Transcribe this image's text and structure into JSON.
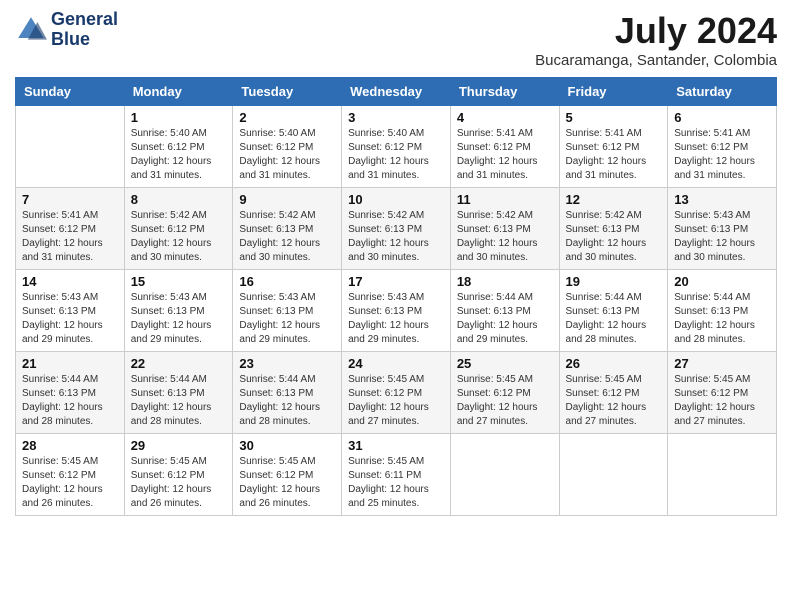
{
  "header": {
    "logo_line1": "General",
    "logo_line2": "Blue",
    "month_year": "July 2024",
    "location": "Bucaramanga, Santander, Colombia"
  },
  "weekdays": [
    "Sunday",
    "Monday",
    "Tuesday",
    "Wednesday",
    "Thursday",
    "Friday",
    "Saturday"
  ],
  "weeks": [
    [
      {
        "day": "",
        "sunrise": "",
        "sunset": "",
        "daylight": ""
      },
      {
        "day": "1",
        "sunrise": "Sunrise: 5:40 AM",
        "sunset": "Sunset: 6:12 PM",
        "daylight": "Daylight: 12 hours and 31 minutes."
      },
      {
        "day": "2",
        "sunrise": "Sunrise: 5:40 AM",
        "sunset": "Sunset: 6:12 PM",
        "daylight": "Daylight: 12 hours and 31 minutes."
      },
      {
        "day": "3",
        "sunrise": "Sunrise: 5:40 AM",
        "sunset": "Sunset: 6:12 PM",
        "daylight": "Daylight: 12 hours and 31 minutes."
      },
      {
        "day": "4",
        "sunrise": "Sunrise: 5:41 AM",
        "sunset": "Sunset: 6:12 PM",
        "daylight": "Daylight: 12 hours and 31 minutes."
      },
      {
        "day": "5",
        "sunrise": "Sunrise: 5:41 AM",
        "sunset": "Sunset: 6:12 PM",
        "daylight": "Daylight: 12 hours and 31 minutes."
      },
      {
        "day": "6",
        "sunrise": "Sunrise: 5:41 AM",
        "sunset": "Sunset: 6:12 PM",
        "daylight": "Daylight: 12 hours and 31 minutes."
      }
    ],
    [
      {
        "day": "7",
        "sunrise": "Sunrise: 5:41 AM",
        "sunset": "Sunset: 6:12 PM",
        "daylight": "Daylight: 12 hours and 31 minutes."
      },
      {
        "day": "8",
        "sunrise": "Sunrise: 5:42 AM",
        "sunset": "Sunset: 6:12 PM",
        "daylight": "Daylight: 12 hours and 30 minutes."
      },
      {
        "day": "9",
        "sunrise": "Sunrise: 5:42 AM",
        "sunset": "Sunset: 6:13 PM",
        "daylight": "Daylight: 12 hours and 30 minutes."
      },
      {
        "day": "10",
        "sunrise": "Sunrise: 5:42 AM",
        "sunset": "Sunset: 6:13 PM",
        "daylight": "Daylight: 12 hours and 30 minutes."
      },
      {
        "day": "11",
        "sunrise": "Sunrise: 5:42 AM",
        "sunset": "Sunset: 6:13 PM",
        "daylight": "Daylight: 12 hours and 30 minutes."
      },
      {
        "day": "12",
        "sunrise": "Sunrise: 5:42 AM",
        "sunset": "Sunset: 6:13 PM",
        "daylight": "Daylight: 12 hours and 30 minutes."
      },
      {
        "day": "13",
        "sunrise": "Sunrise: 5:43 AM",
        "sunset": "Sunset: 6:13 PM",
        "daylight": "Daylight: 12 hours and 30 minutes."
      }
    ],
    [
      {
        "day": "14",
        "sunrise": "Sunrise: 5:43 AM",
        "sunset": "Sunset: 6:13 PM",
        "daylight": "Daylight: 12 hours and 29 minutes."
      },
      {
        "day": "15",
        "sunrise": "Sunrise: 5:43 AM",
        "sunset": "Sunset: 6:13 PM",
        "daylight": "Daylight: 12 hours and 29 minutes."
      },
      {
        "day": "16",
        "sunrise": "Sunrise: 5:43 AM",
        "sunset": "Sunset: 6:13 PM",
        "daylight": "Daylight: 12 hours and 29 minutes."
      },
      {
        "day": "17",
        "sunrise": "Sunrise: 5:43 AM",
        "sunset": "Sunset: 6:13 PM",
        "daylight": "Daylight: 12 hours and 29 minutes."
      },
      {
        "day": "18",
        "sunrise": "Sunrise: 5:44 AM",
        "sunset": "Sunset: 6:13 PM",
        "daylight": "Daylight: 12 hours and 29 minutes."
      },
      {
        "day": "19",
        "sunrise": "Sunrise: 5:44 AM",
        "sunset": "Sunset: 6:13 PM",
        "daylight": "Daylight: 12 hours and 28 minutes."
      },
      {
        "day": "20",
        "sunrise": "Sunrise: 5:44 AM",
        "sunset": "Sunset: 6:13 PM",
        "daylight": "Daylight: 12 hours and 28 minutes."
      }
    ],
    [
      {
        "day": "21",
        "sunrise": "Sunrise: 5:44 AM",
        "sunset": "Sunset: 6:13 PM",
        "daylight": "Daylight: 12 hours and 28 minutes."
      },
      {
        "day": "22",
        "sunrise": "Sunrise: 5:44 AM",
        "sunset": "Sunset: 6:13 PM",
        "daylight": "Daylight: 12 hours and 28 minutes."
      },
      {
        "day": "23",
        "sunrise": "Sunrise: 5:44 AM",
        "sunset": "Sunset: 6:13 PM",
        "daylight": "Daylight: 12 hours and 28 minutes."
      },
      {
        "day": "24",
        "sunrise": "Sunrise: 5:45 AM",
        "sunset": "Sunset: 6:12 PM",
        "daylight": "Daylight: 12 hours and 27 minutes."
      },
      {
        "day": "25",
        "sunrise": "Sunrise: 5:45 AM",
        "sunset": "Sunset: 6:12 PM",
        "daylight": "Daylight: 12 hours and 27 minutes."
      },
      {
        "day": "26",
        "sunrise": "Sunrise: 5:45 AM",
        "sunset": "Sunset: 6:12 PM",
        "daylight": "Daylight: 12 hours and 27 minutes."
      },
      {
        "day": "27",
        "sunrise": "Sunrise: 5:45 AM",
        "sunset": "Sunset: 6:12 PM",
        "daylight": "Daylight: 12 hours and 27 minutes."
      }
    ],
    [
      {
        "day": "28",
        "sunrise": "Sunrise: 5:45 AM",
        "sunset": "Sunset: 6:12 PM",
        "daylight": "Daylight: 12 hours and 26 minutes."
      },
      {
        "day": "29",
        "sunrise": "Sunrise: 5:45 AM",
        "sunset": "Sunset: 6:12 PM",
        "daylight": "Daylight: 12 hours and 26 minutes."
      },
      {
        "day": "30",
        "sunrise": "Sunrise: 5:45 AM",
        "sunset": "Sunset: 6:12 PM",
        "daylight": "Daylight: 12 hours and 26 minutes."
      },
      {
        "day": "31",
        "sunrise": "Sunrise: 5:45 AM",
        "sunset": "Sunset: 6:11 PM",
        "daylight": "Daylight: 12 hours and 25 minutes."
      },
      {
        "day": "",
        "sunrise": "",
        "sunset": "",
        "daylight": ""
      },
      {
        "day": "",
        "sunrise": "",
        "sunset": "",
        "daylight": ""
      },
      {
        "day": "",
        "sunrise": "",
        "sunset": "",
        "daylight": ""
      }
    ]
  ]
}
